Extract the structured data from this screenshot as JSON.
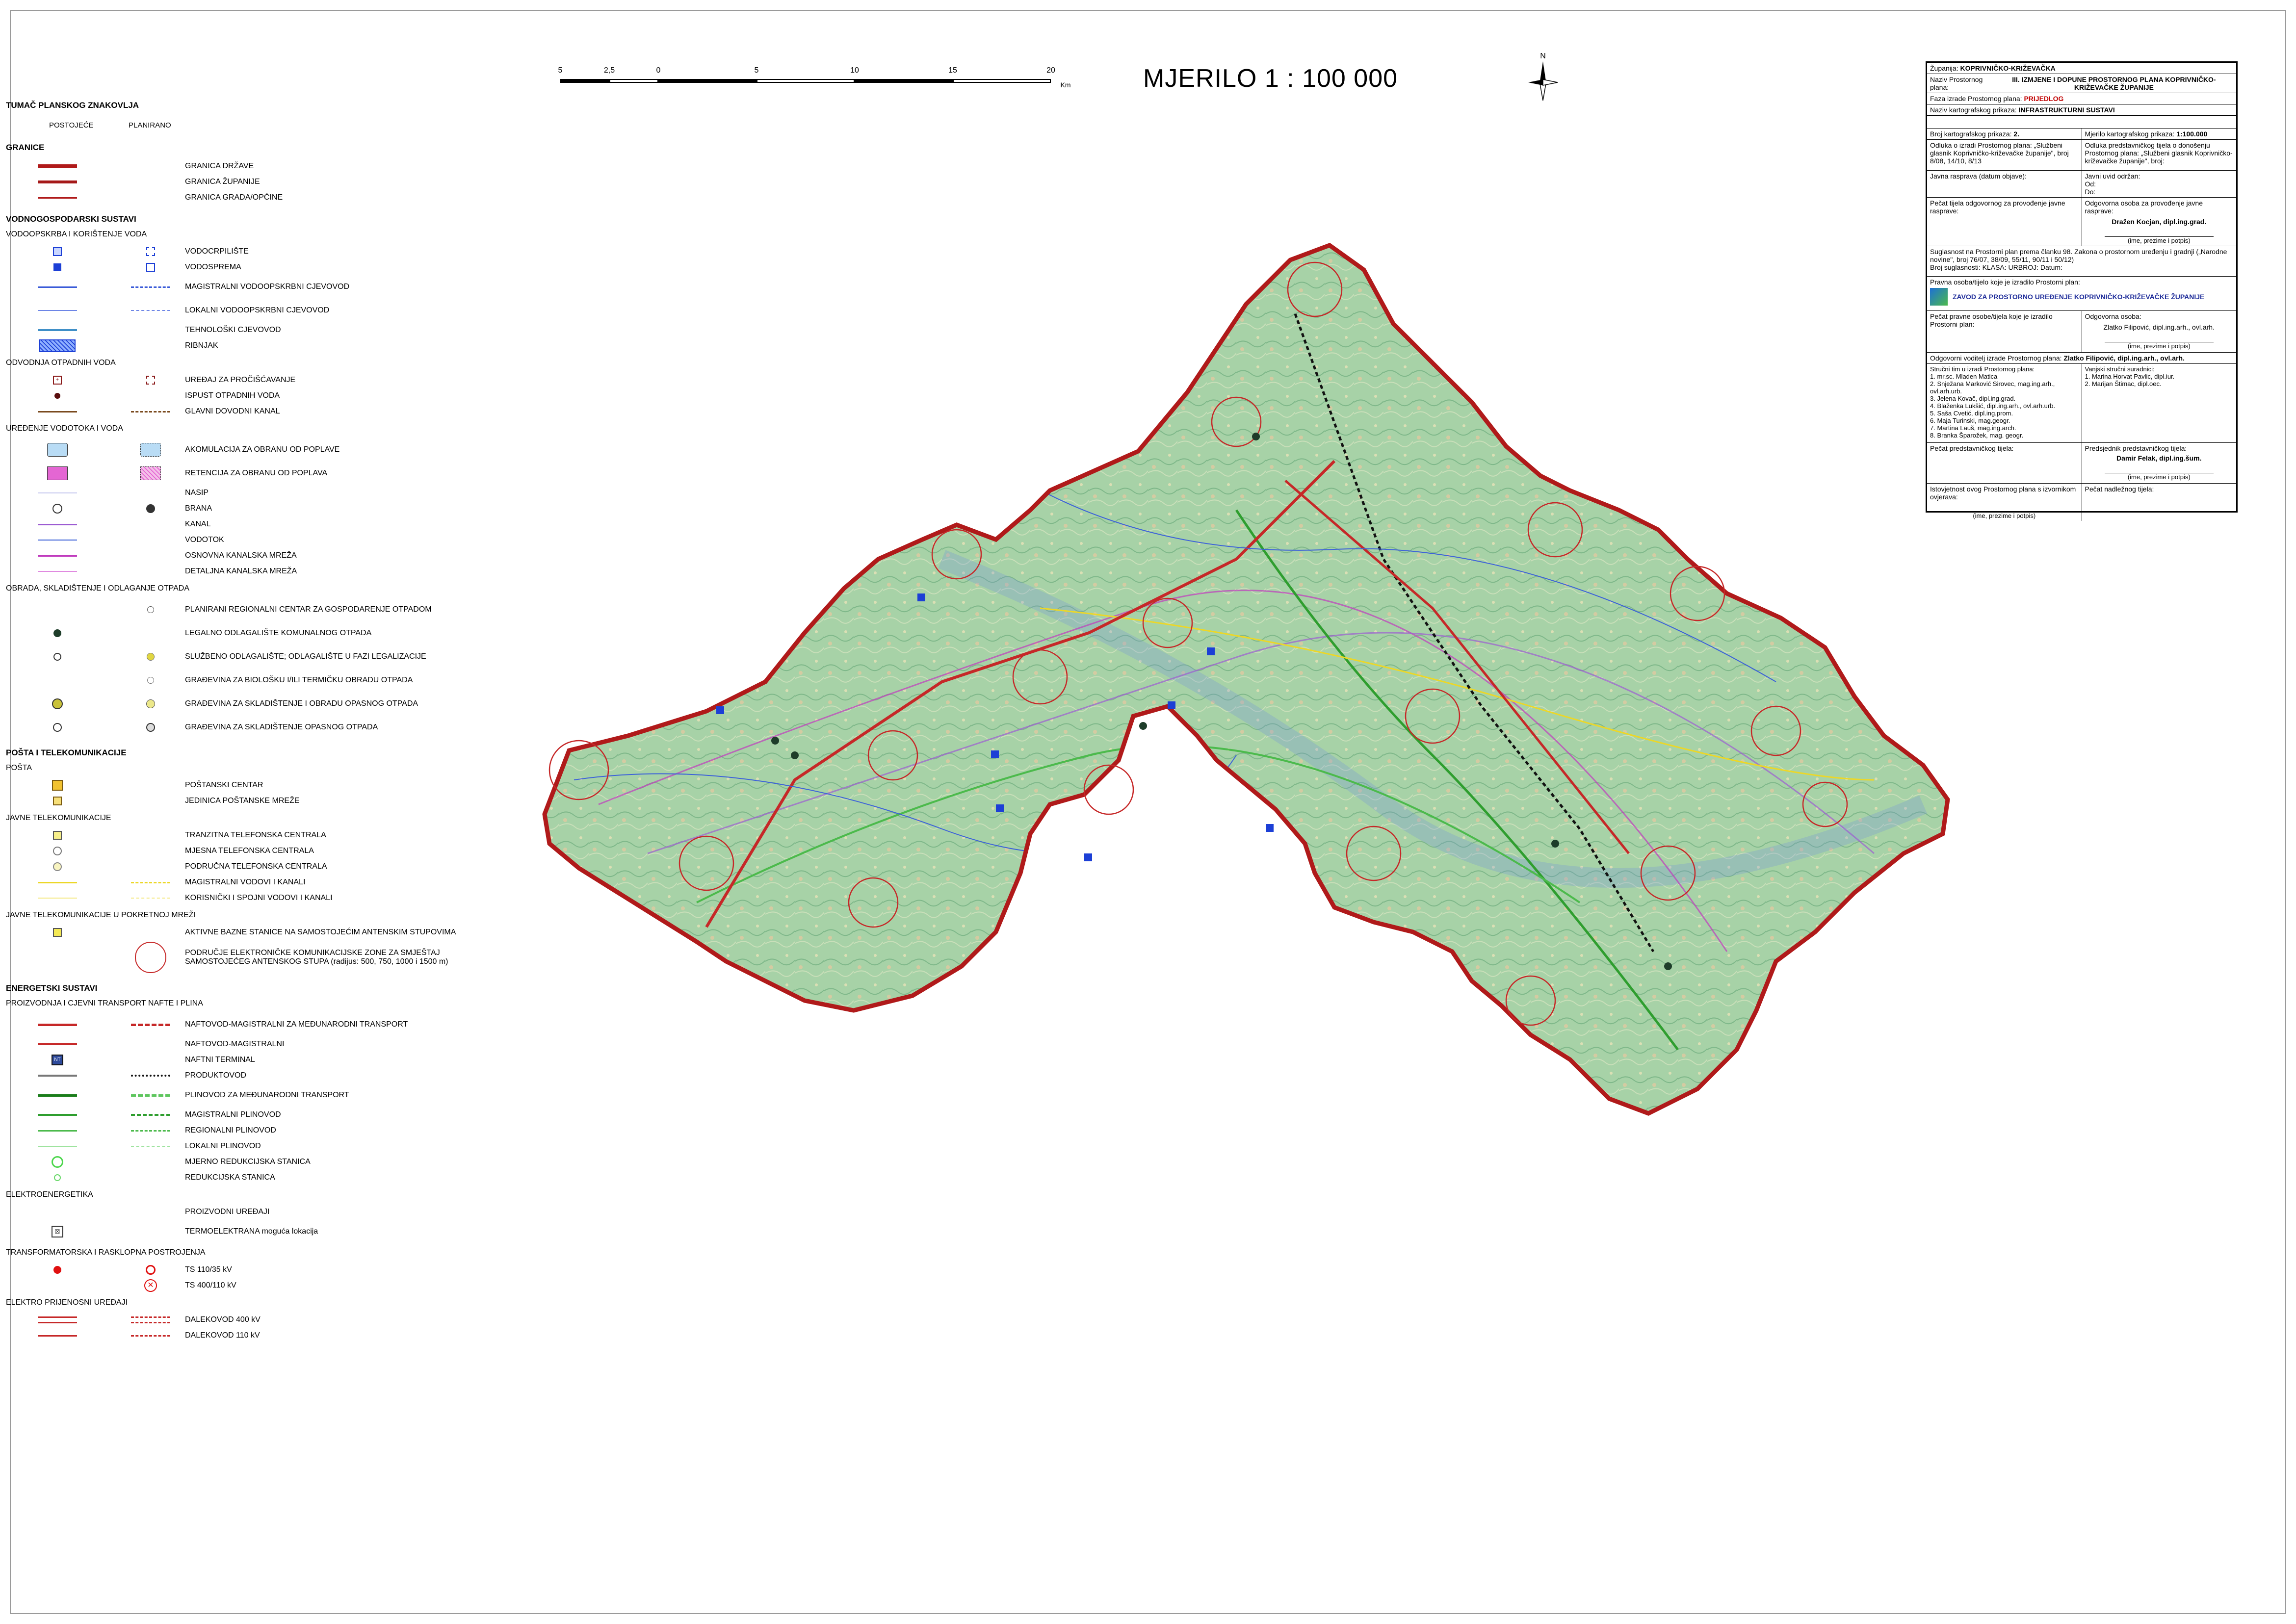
{
  "scale_title": "MJERILO 1 : 100 000",
  "scale_bar": {
    "ticks": [
      "5",
      "2,5",
      "0",
      "5",
      "10",
      "15",
      "20"
    ],
    "unit": "Km"
  },
  "north_label": "N",
  "legend": {
    "title": "TUMAČ PLANSKOG ZNAKOVLJA",
    "header_existing": "POSTOJEĆE",
    "header_planned": "PLANIRANO",
    "granice": {
      "heading": "GRANICE",
      "items": [
        {
          "label": "GRANICA DRŽAVE",
          "color": "#b01a1a"
        },
        {
          "label": "GRANICA ŽUPANIJE",
          "color": "#b01a1a"
        },
        {
          "label": "GRANICA GRADA/OPĆINE",
          "color": "#b01a1a"
        }
      ]
    },
    "vodno": {
      "heading": "VODNOGOSPODARSKI SUSTAVI",
      "sub1": "VODOOPSKRBA I KORIŠTENJE VODA",
      "items1": [
        {
          "label": "VODOCRPILIŠTE"
        },
        {
          "label": "VODOSPREMA"
        },
        {
          "label": "MAGISTRALNI VODOOPSKRBNI CJEVOVOD"
        },
        {
          "label": "LOKALNI VODOOPSKRBNI CJEVOVOD"
        },
        {
          "label": "TEHNOLOŠKI CJEVOVOD"
        },
        {
          "label": "RIBNJAK"
        }
      ],
      "sub2": "ODVODNJA OTPADNIH VODA",
      "items2": [
        {
          "label": "UREĐAJ ZA PROČIŠĆAVANJE"
        },
        {
          "label": "ISPUST OTPADNIH VODA"
        },
        {
          "label": "GLAVNI DOVODNI KANAL"
        }
      ],
      "sub3": "UREĐENJE VODOTOKA I VODA",
      "items3": [
        {
          "label": "AKOMULACIJA ZA OBRANU OD POPLAVE"
        },
        {
          "label": "RETENCIJA ZA OBRANU OD POPLAVA"
        },
        {
          "label": "NASIP"
        },
        {
          "label": "BRANA"
        },
        {
          "label": "KANAL"
        },
        {
          "label": "VODOTOK"
        },
        {
          "label": "OSNOVNA KANALSKA MREŽA"
        },
        {
          "label": "DETALJNA KANALSKA MREŽA"
        }
      ],
      "sub4": "OBRADA, SKLADIŠTENJE I ODLAGANJE OTPADA",
      "items4": [
        {
          "label": "PLANIRANI REGIONALNI CENTAR ZA GOSPODARENJE OTPADOM"
        },
        {
          "label": "LEGALNO ODLAGALIŠTE KOMUNALNOG OTPADA"
        },
        {
          "label": "SLUŽBENO ODLAGALIŠTE; ODLAGALIŠTE U FAZI LEGALIZACIJE"
        },
        {
          "label": "GRAĐEVINA ZA BIOLOŠKU I/ILI TERMIČKU OBRADU OTPADA"
        },
        {
          "label": "GRAĐEVINA ZA SKLADIŠTENJE I OBRADU OPASNOG OTPADA"
        },
        {
          "label": "GRAĐEVINA ZA SKLADIŠTENJE OPASNOG OTPADA"
        }
      ]
    },
    "posta": {
      "heading": "POŠTA I TELEKOMUNIKACIJE",
      "sub1": "POŠTA",
      "items1": [
        {
          "label": "POŠTANSKI CENTAR"
        },
        {
          "label": "JEDINICA POŠTANSKE MREŽE"
        }
      ],
      "sub2": "JAVNE TELEKOMUNIKACIJE",
      "items2": [
        {
          "label": "TRANZITNA TELEFONSKA CENTRALA"
        },
        {
          "label": "MJESNA TELEFONSKA CENTRALA"
        },
        {
          "label": "PODRUČNA TELEFONSKA CENTRALA"
        },
        {
          "label": "MAGISTRALNI VODOVI I KANALI"
        },
        {
          "label": "KORISNIČKI I SPOJNI VODOVI I KANALI"
        }
      ],
      "sub3": "JAVNE TELEKOMUNIKACIJE U POKRETNOJ MREŽI",
      "items3": [
        {
          "label": "AKTIVNE BAZNE STANICE NA SAMOSTOJEĆIM ANTENSKIM STUPOVIMA"
        },
        {
          "label": "PODRUČJE ELEKTRONIČKE KOMUNIKACIJSKE ZONE ZA SMJEŠTAJ SAMOSTOJEĆEG ANTENSKOG STUPA (radijus: 500, 750, 1000 i 1500 m)"
        }
      ]
    },
    "energetski": {
      "heading": "ENERGETSKI SUSTAVI",
      "sub1": "PROIZVODNJA I CJEVNI TRANSPORT NAFTE I PLINA",
      "items1": [
        {
          "label": "NAFTOVOD-MAGISTRALNI ZA MEĐUNARODNI TRANSPORT"
        },
        {
          "label": "NAFTOVOD-MAGISTRALNI"
        },
        {
          "label": "NAFTNI TERMINAL"
        },
        {
          "label": "PRODUKTOVOD"
        },
        {
          "label": "PLINOVOD ZA MEĐUNARODNI TRANSPORT"
        },
        {
          "label": "MAGISTRALNI PLINOVOD"
        },
        {
          "label": "REGIONALNI PLINOVOD"
        },
        {
          "label": "LOKALNI PLINOVOD"
        },
        {
          "label": "MJERNO REDUKCIJSKA STANICA"
        },
        {
          "label": "REDUKCIJSKA STANICA"
        }
      ],
      "sub2": "ELEKTROENERGETIKA",
      "items2": [
        {
          "label": "PROIZVODNI UREĐAJI"
        },
        {
          "label": "TERMOELEKTRANA moguća lokacija"
        }
      ],
      "sub3": "TRANSFORMATORSKA I RASKLOPNA POSTROJENJA",
      "items3": [
        {
          "label": "TS 110/35 kV"
        },
        {
          "label": "TS 400/110 kV"
        }
      ],
      "sub4": "ELEKTRO PRIJENOSNI UREĐAJI",
      "items4": [
        {
          "label": "DALEKOVOD 400 kV"
        },
        {
          "label": "DALEKOVOD 110 kV"
        }
      ]
    }
  },
  "title_block": {
    "zupanija_label": "Županija:",
    "zupanija_value": "KOPRIVNIČKO-KRIŽEVAČKA",
    "naziv_label": "Naziv Prostornog plana:",
    "naziv_value": "III. IZMJENE I DOPUNE PROSTORNOG PLANA KOPRIVNIČKO-KRIŽEVAČKE ŽUPANIJE",
    "faza_label": "Faza izrade Prostornog plana:",
    "faza_value": "PRIJEDLOG",
    "prikaz_label": "Naziv kartografskog prikaza:",
    "prikaz_value": "INFRASTRUKTURNI SUSTAVI",
    "broj_label": "Broj kartografskog prikaza:",
    "broj_value": "2.",
    "mjerilo_label": "Mjerilo kartografskog prikaza:",
    "mjerilo_value": "1:100.000",
    "odluka_izradi": "Odluka o izradi Prostornog plana: „Službeni glasnik Koprivničko-križevačke županije\", broj 8/08, 14/10, 8/13",
    "odluka_donosenju": "Odluka predstavničkog tijela o donošenju Prostornog plana: „Službeni glasnik Koprivničko-križevačke županije\", broj:",
    "javna_rasprava": "Javna rasprava (datum objave):",
    "javni_uvid": "Javni uvid održan:",
    "javni_od": "Od:",
    "javni_do": "Do:",
    "pecat_tijela": "Pečat tijela odgovornog za provođenje javne rasprave:",
    "odgovorna_osoba_label": "Odgovorna osoba za provođenje javne rasprave:",
    "odgovorna_osoba": "Dražen Kocjan, dipl.ing.grad.",
    "potpis": "(ime, prezime i potpis)",
    "suglasnost": "Suglasnost na Prostorni plan prema članku 98. Zakona o prostornom uređenju i gradnji („Narodne novine\", broj 76/07, 38/09, 55/11, 90/11 i 50/12)",
    "suglasnost_broj": "Broj suglasnosti: KLASA: URBROJ: Datum:",
    "pravna_osoba": "Pravna osoba/tijelo koje je izradilo Prostorni plan:",
    "zavod": "ZAVOD ZA PROSTORNO UREĐENJE KOPRIVNIČKO-KRIŽEVAČKE ŽUPANIJE",
    "pecat_pravne": "Pečat pravne osobe/tijela koje je izradilo Prostorni plan:",
    "odgovorna_osoba2_label": "Odgovorna osoba:",
    "odgovorna_osoba2": "Zlatko Filipović, dipl.ing.arh., ovl.arh.",
    "voditelj_label": "Odgovorni voditelj izrade Prostornog plana:",
    "voditelj": "Zlatko Filipović, dipl.ing.arh., ovl.arh.",
    "strucni_label": "Stručni tim u izradi Prostornog plana:",
    "vanjski_label": "Vanjski stručni suradnici:",
    "tim": [
      "1. mr.sc. Mladen Matica",
      "2. Snježana Marković Sirovec, mag.ing.arh., ovl.arh.urb.",
      "3. Jelena Kovač, dipl.ing.grad.",
      "4. Blaženka Lukšić, dipl.ing.arh., ovl.arh.urb.",
      "5. Saša Cvetić, dipl.ing.prom.",
      "6. Maja Turinski, mag.geogr.",
      "7. Martina Lauš, mag.ing.arch.",
      "8. Branka Šparožek, mag. geogr."
    ],
    "vanjski": [
      "1. Marina Horvat Pavlic, dipl.iur.",
      "2. Marijan Štimac, dipl.oec."
    ],
    "pecat_predstavnickog": "Pečat predstavničkog tijela:",
    "predsjednik_label": "Predsjednik predstavničkog tijela:",
    "predsjednik": "Damir Felak, dipl.ing.šum.",
    "istovjetnost": "Istovjetnost ovog Prostornog plana s izvornikom ovjerava:",
    "pecat_nadleznog": "Pečat nadležnog tijela:"
  }
}
